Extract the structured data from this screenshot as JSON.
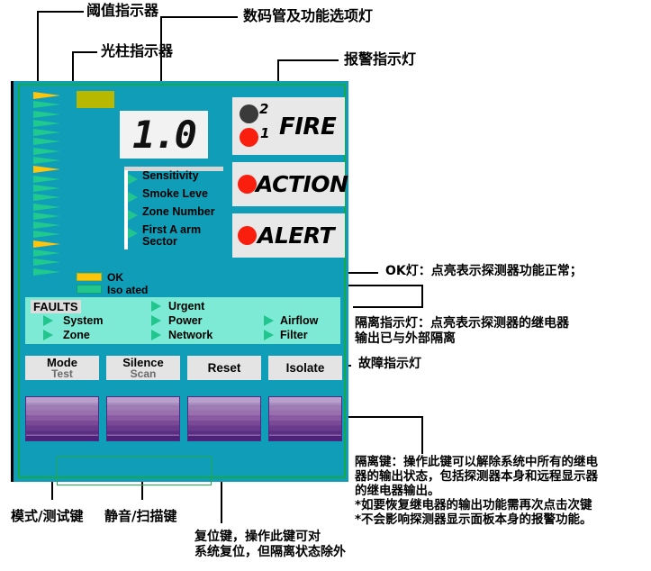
{
  "diagram": {
    "title_annotations": [
      {
        "id": "threshold",
        "text": "阈值指示器"
      },
      {
        "id": "bargraph",
        "text": "光柱指示器"
      },
      {
        "id": "digital-display",
        "text": "数码管及功能选项灯"
      },
      {
        "id": "alarm-lamps",
        "text": "报警指示灯"
      },
      {
        "id": "ok-lamp",
        "text": "OK灯：点亮表示探测器功能正常；"
      },
      {
        "id": "isolate-lamp",
        "text": "隔离指示灯：点亮表示探测器的继电器\n输出已与外部隔离"
      },
      {
        "id": "fault-lamps",
        "text": "故障指示灯"
      },
      {
        "id": "isolate-key",
        "text": "隔离键：操作此键可以解除系统中所有的继电\n器的输出状态，包括探测器本身和远程显示器\n的继电器输出。\n*如要恢复继电器的输出功能需再次点击次键\n*不会影响探测器显示面板本身的报警功能。"
      },
      {
        "id": "mode-test-key",
        "text": "模式/测试键"
      },
      {
        "id": "silence-scan-key",
        "text": "静音/扫描键"
      },
      {
        "id": "reset-key",
        "text": "复位键，操作此键可对\n系统复位，但隔离状态除外"
      }
    ]
  },
  "panel": {
    "colors": {
      "background": "#0f9db8",
      "border_green": "#16a94a",
      "led_yellow": "#ffc40c",
      "led_green": "#23c58f",
      "alarm_red": "#fa1e0e",
      "alarm_off": "#3a3a3a",
      "faults_bg": "#7cead4",
      "button_face": "#e4e4e4",
      "slab_purple": "#7b4a96"
    },
    "bargraph": {
      "threshold_total": 20,
      "threshold_lit_positions": [
        1,
        9,
        17
      ],
      "segment_total": 21,
      "segments_lit": 21
    },
    "status_leds": [
      {
        "name": "ok",
        "label": "OK",
        "color": "#ffc40c",
        "state": "on"
      },
      {
        "name": "isolated",
        "label": "Iso ated",
        "color": "#23c58f",
        "state": "on"
      }
    ],
    "display": {
      "value": "1.0"
    },
    "function_menu": [
      {
        "label": "Sensitivity"
      },
      {
        "label": "Smoke Leve"
      },
      {
        "label": "Zone Number"
      },
      {
        "label": "First A arm\nSector"
      }
    ],
    "alarms": [
      {
        "name": "fire",
        "label": "FIRE",
        "leds": [
          {
            "number": "2",
            "state": "off"
          },
          {
            "number": "1",
            "state": "on"
          }
        ]
      },
      {
        "name": "action",
        "label": "ACTION",
        "leds": [
          {
            "number": "",
            "state": "on"
          }
        ]
      },
      {
        "name": "alert",
        "label": "ALERT",
        "leds": [
          {
            "number": "",
            "state": "on"
          }
        ]
      }
    ],
    "faults": {
      "title": "FAULTS",
      "columns": [
        [
          "System",
          "Zone"
        ],
        [
          "Urgent",
          "Power",
          "Network"
        ],
        [
          "Airflow",
          "Filter"
        ]
      ]
    },
    "buttons": [
      {
        "name": "mode-test",
        "line1": "Mode",
        "line2": "Test"
      },
      {
        "name": "silence-scan",
        "line1": "Silence",
        "line2": "Scan"
      },
      {
        "name": "reset",
        "line1": "Reset",
        "line2": ""
      },
      {
        "name": "isolate",
        "line1": "Isolate",
        "line2": ""
      }
    ],
    "slab_buttons": [
      {
        "name": "slab-mode-test"
      },
      {
        "name": "slab-silence-scan"
      },
      {
        "name": "slab-reset"
      },
      {
        "name": "slab-isolate"
      }
    ]
  }
}
